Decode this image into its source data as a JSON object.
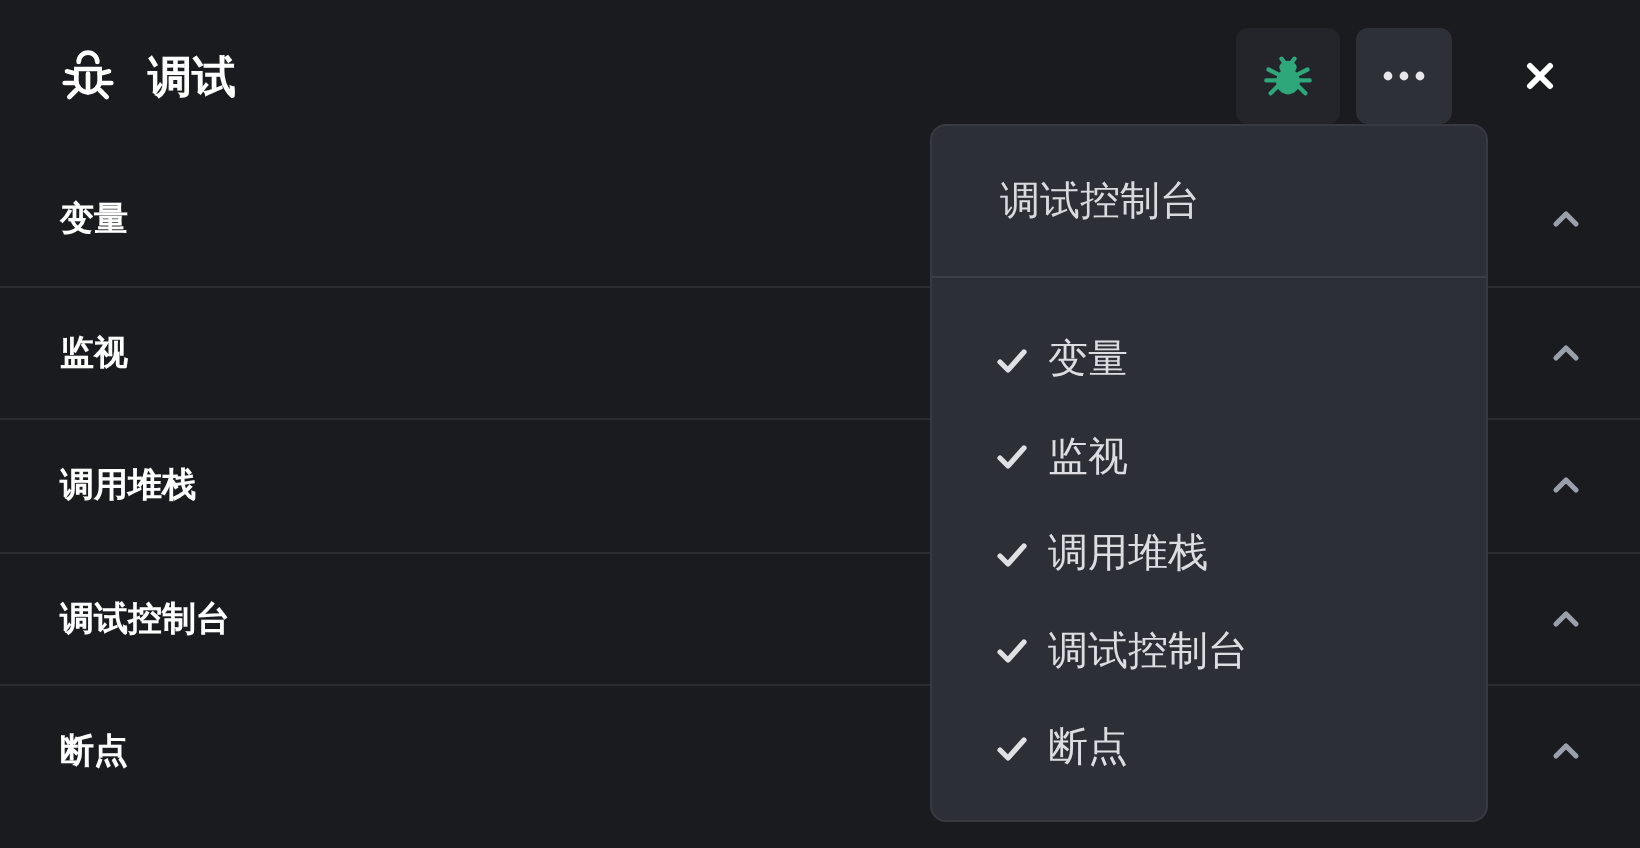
{
  "header": {
    "title": "调试"
  },
  "sections": [
    {
      "title": "变量"
    },
    {
      "title": "监视"
    },
    {
      "title": "调用堆栈"
    },
    {
      "title": "调试控制台"
    },
    {
      "title": "断点"
    }
  ],
  "menu": {
    "title": "调试控制台",
    "items": [
      {
        "label": "变量",
        "checked": true
      },
      {
        "label": "监视",
        "checked": true
      },
      {
        "label": "调用堆栈",
        "checked": true
      },
      {
        "label": "调试控制台",
        "checked": true
      },
      {
        "label": "断点",
        "checked": true
      }
    ]
  }
}
